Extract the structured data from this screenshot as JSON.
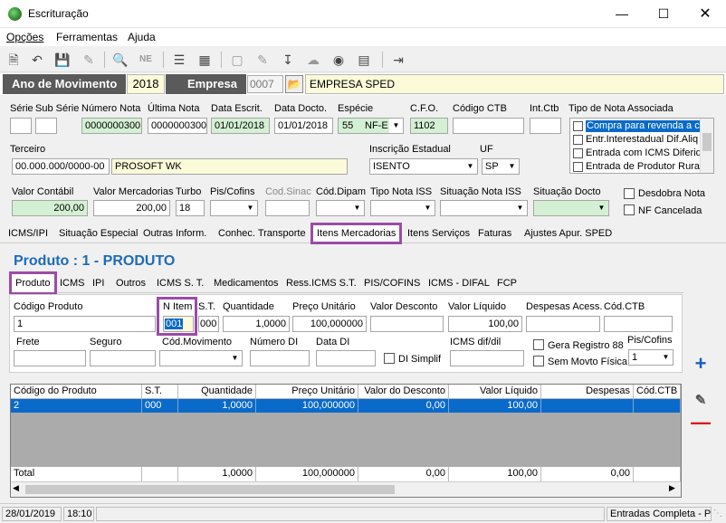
{
  "window": {
    "title": "Escrituração"
  },
  "menu": [
    "Opções",
    "Ferramentas",
    "Ajuda"
  ],
  "yearbar": {
    "ano_label": "Ano de Movimento",
    "ano_value": "2018",
    "empresa_label": "Empresa",
    "empresa_code": "0007",
    "empresa_name": "EMPRESA SPED"
  },
  "header": {
    "serie_label": "Série",
    "subserie_label": "Sub Série",
    "numero_nota_label": "Número Nota",
    "numero_nota": "0000000300",
    "ultima_nota_label": "Última Nota",
    "ultima_nota": "0000000300",
    "data_escrit_label": "Data Escrit.",
    "data_escrit": "01/01/2018",
    "data_docto_label": "Data Docto.",
    "data_docto": "01/01/2018",
    "especie_label": "Espécie",
    "especie_code": "55",
    "especie_value": "NF-E",
    "cfo_label": "C.F.O.",
    "cfo": "1102",
    "codigo_ctb_label": "Código CTB",
    "int_ctb_label": "Int.Ctb",
    "tipo_nota_label": "Tipo de Nota Associada",
    "tipo_nota_items": [
      {
        "label": "Compra para revenda a co",
        "selected": true
      },
      {
        "label": "Entr.Interestadual Dif.Aliq",
        "selected": false
      },
      {
        "label": "Entrada com ICMS Diferido",
        "selected": false
      },
      {
        "label": "Entrada de Produtor Rural",
        "selected": false
      }
    ],
    "terceiro_label": "Terceiro",
    "terceiro_code": "00.000.000/0000-00",
    "terceiro_name": "PROSOFT WK",
    "ie_label": "Inscrição Estadual",
    "ie_value": "ISENTO",
    "uf_label": "UF",
    "uf_value": "SP",
    "valor_contabil_label": "Valor Contábil",
    "valor_contabil": "200,00",
    "valor_mercadorias_label": "Valor Mercadorias",
    "valor_mercadorias": "200,00",
    "turbo_label": "Turbo",
    "turbo": "18",
    "pis_cofins_label": "Pis/Cofins",
    "cod_sinac_label": "Cod.Sinac",
    "cod_dipam_label": "Cód.Dipam",
    "tipo_nota_iss_label": "Tipo Nota ISS",
    "situacao_nota_iss_label": "Situação Nota ISS",
    "situacao_docto_label": "Situação Docto",
    "desdobra_nota_label": "Desdobra Nota",
    "nf_cancelada_label": "NF Cancelada"
  },
  "main_tabs": [
    "ICMS/IPI",
    "Situação Especial",
    "Outras Inform.",
    "Conhec. Transporte",
    "Itens Mercadorias",
    "Itens Serviços",
    "Faturas",
    "Ajustes Apur. SPED"
  ],
  "product_title": "Produto : 1 - PRODUTO",
  "sub_tabs": [
    "Produto",
    "ICMS",
    "IPI",
    "Outros",
    "ICMS S. T.",
    "Medicamentos",
    "Ress.ICMS S.T.",
    "PIS/COFINS",
    "ICMS - DIFAL",
    "FCP"
  ],
  "produto": {
    "codigo_label": "Código Produto",
    "codigo": "1",
    "n_item_label": "N Item",
    "n_item": "001",
    "st_label": "S.T.",
    "st": "000",
    "quantidade_label": "Quantidade",
    "quantidade": "1,0000",
    "preco_label": "Preço Unitário",
    "preco": "100,000000",
    "desconto_label": "Valor Desconto",
    "liquido_label": "Valor Líquido",
    "liquido": "100,00",
    "despesas_label": "Despesas Acess.",
    "cod_ctb_label": "Cód.CTB",
    "frete_label": "Frete",
    "seguro_label": "Seguro",
    "cod_mov_label": "Cód.Movimento",
    "numero_di_label": "Número DI",
    "data_di_label": "Data DI",
    "di_simplif_label": "DI Simplif",
    "icms_dif_label": "ICMS dif/dil",
    "gera_registro_label": "Gera Registro 88",
    "sem_movto_label": "Sem Movto Física",
    "pis_cofins_label": "Pis/Cofins",
    "pis_cofins": "1"
  },
  "grid": {
    "headers": [
      "Código do Produto",
      "S.T.",
      "Quantidade",
      "Preço Unitário",
      "Valor do Desconto",
      "Valor Líquido",
      "Despesas",
      "Cód.CTB"
    ],
    "row": [
      "2",
      "000",
      "1,0000",
      "100,000000",
      "0,00",
      "100,00",
      "",
      ""
    ],
    "totals": [
      "Total",
      "",
      "1,0000",
      "100,000000",
      "0,00",
      "100,00",
      "0,00",
      ""
    ]
  },
  "status": {
    "date": "28/01/2019",
    "time": "18:10",
    "mode": "Entradas Completa - P"
  }
}
